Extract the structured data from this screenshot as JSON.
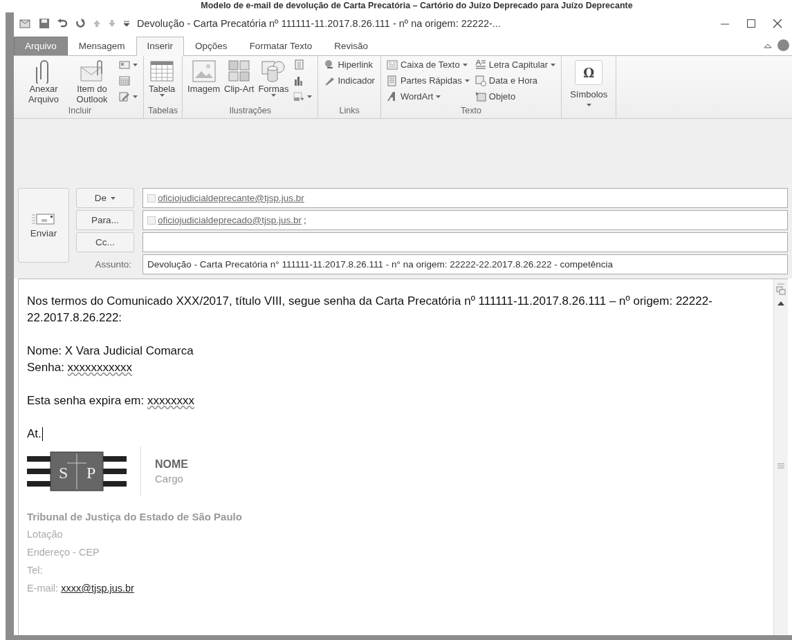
{
  "caption": "Modelo de e-mail de devolução de Carta Precatória – Cartório do Juízo Deprecado para Juízo Deprecante",
  "title_bar": {
    "title": "Devolução - Carta Precatória nº 111111-11.2017.8.26.111 - nº na origem: 22222-..."
  },
  "tabs": [
    {
      "label": "Arquivo",
      "kind": "file",
      "selected": false
    },
    {
      "label": "Mensagem",
      "kind": "tab",
      "selected": false
    },
    {
      "label": "Inserir",
      "kind": "tab",
      "selected": true
    },
    {
      "label": "Opções",
      "kind": "tab",
      "selected": false
    },
    {
      "label": "Formatar Texto",
      "kind": "tab",
      "selected": false
    },
    {
      "label": "Revisão",
      "kind": "tab",
      "selected": false
    }
  ],
  "ribbon_groups": [
    {
      "label": "Incluir",
      "columns": [
        [
          {
            "kind": "large",
            "label": "Anexar Arquivo",
            "dropdown": false
          }
        ],
        [
          {
            "kind": "large",
            "label": "Item do Outlook",
            "dropdown": false
          }
        ],
        [
          {
            "kind": "small",
            "dropdown": true
          },
          {
            "kind": "small",
            "dropdown": false
          },
          {
            "kind": "small",
            "dropdown": true
          }
        ]
      ]
    },
    {
      "label": "Tabelas",
      "columns": [
        [
          {
            "kind": "large",
            "label": "Tabela",
            "dropdown": true
          }
        ]
      ]
    },
    {
      "label": "Ilustrações",
      "columns": [
        [
          {
            "kind": "large",
            "label": "Imagem",
            "dropdown": false
          }
        ],
        [
          {
            "kind": "large",
            "label": "Clip-Art",
            "dropdown": false
          }
        ],
        [
          {
            "kind": "large",
            "label": "Formas",
            "dropdown": true
          }
        ],
        [
          {
            "kind": "small",
            "dropdown": false
          },
          {
            "kind": "small",
            "dropdown": false
          },
          {
            "kind": "small",
            "dropdown": true
          }
        ]
      ]
    },
    {
      "label": "Links",
      "columns": [
        [
          {
            "kind": "small",
            "label": "Hiperlink",
            "dropdown": false
          },
          {
            "kind": "small",
            "label": "Indicador",
            "dropdown": false
          }
        ]
      ]
    },
    {
      "label": "Texto",
      "columns": [
        [
          {
            "kind": "small",
            "label": "Caixa de Texto",
            "dropdown": true
          },
          {
            "kind": "small",
            "label": "Partes Rápidas",
            "dropdown": true
          },
          {
            "kind": "small",
            "label": "WordArt",
            "dropdown": true
          }
        ],
        [
          {
            "kind": "small",
            "label": "Letra Capitular",
            "dropdown": true
          },
          {
            "kind": "small",
            "label": "Data e Hora",
            "dropdown": false
          },
          {
            "kind": "small",
            "label": "Objeto",
            "dropdown": false
          }
        ]
      ]
    },
    {
      "columns": [
        [
          {
            "kind": "symbol",
            "glyph": "Ω",
            "label": "Símbolos",
            "dropdown": true
          }
        ]
      ]
    }
  ],
  "send_button": {
    "label": "Enviar"
  },
  "address_rows": [
    {
      "button": "De",
      "dropdown": true,
      "address": "oficiojudicialdeprecante@tjsp.jus.br",
      "separator": ""
    },
    {
      "button": "Para...",
      "dropdown": false,
      "address": "oficiojudicialdeprecado@tjsp.jus.br",
      "separator": ";"
    },
    {
      "button": "Cc...",
      "dropdown": false,
      "address": "",
      "separator": ""
    }
  ],
  "subject": {
    "label": "Assunto:",
    "value": "Devolução - Carta Precatória n° 111111-11.2017.8.26.111 - n° na origem: 22222-22.2017.8.26.222 - competência"
  },
  "body": [
    [
      {
        "text": "Nos termos do Comunicado XXX/2017, título VIII, segue senha da Carta Precatória nº 111111-11.2017.8.26.111 – nº origem: 22222-22.2017.8.26.222:",
        "cursor": false
      }
    ],
    [
      {
        "text": "Nome: X Vara Judicial Comarca",
        "cursor": false
      },
      {
        "text": "Senha: ",
        "misspelled": "xxxxxxxxxxx",
        "cursor": false
      }
    ],
    [
      {
        "text": "Esta senha expira em: ",
        "misspelled": "xxxxxxxx",
        "cursor": false
      }
    ],
    [
      {
        "text": "At.",
        "cursor": true
      }
    ]
  ],
  "signature": {
    "logo_letters": [
      "S",
      "P"
    ],
    "name": "NOME",
    "role": "Cargo",
    "organization": "Tribunal de Justiça do Estado de São Paulo",
    "lines": [
      "Lotação",
      "Endereço - CEP",
      "Tel:"
    ],
    "email_label": "E-mail: ",
    "email": "xxxx@tjsp.jus.br"
  }
}
